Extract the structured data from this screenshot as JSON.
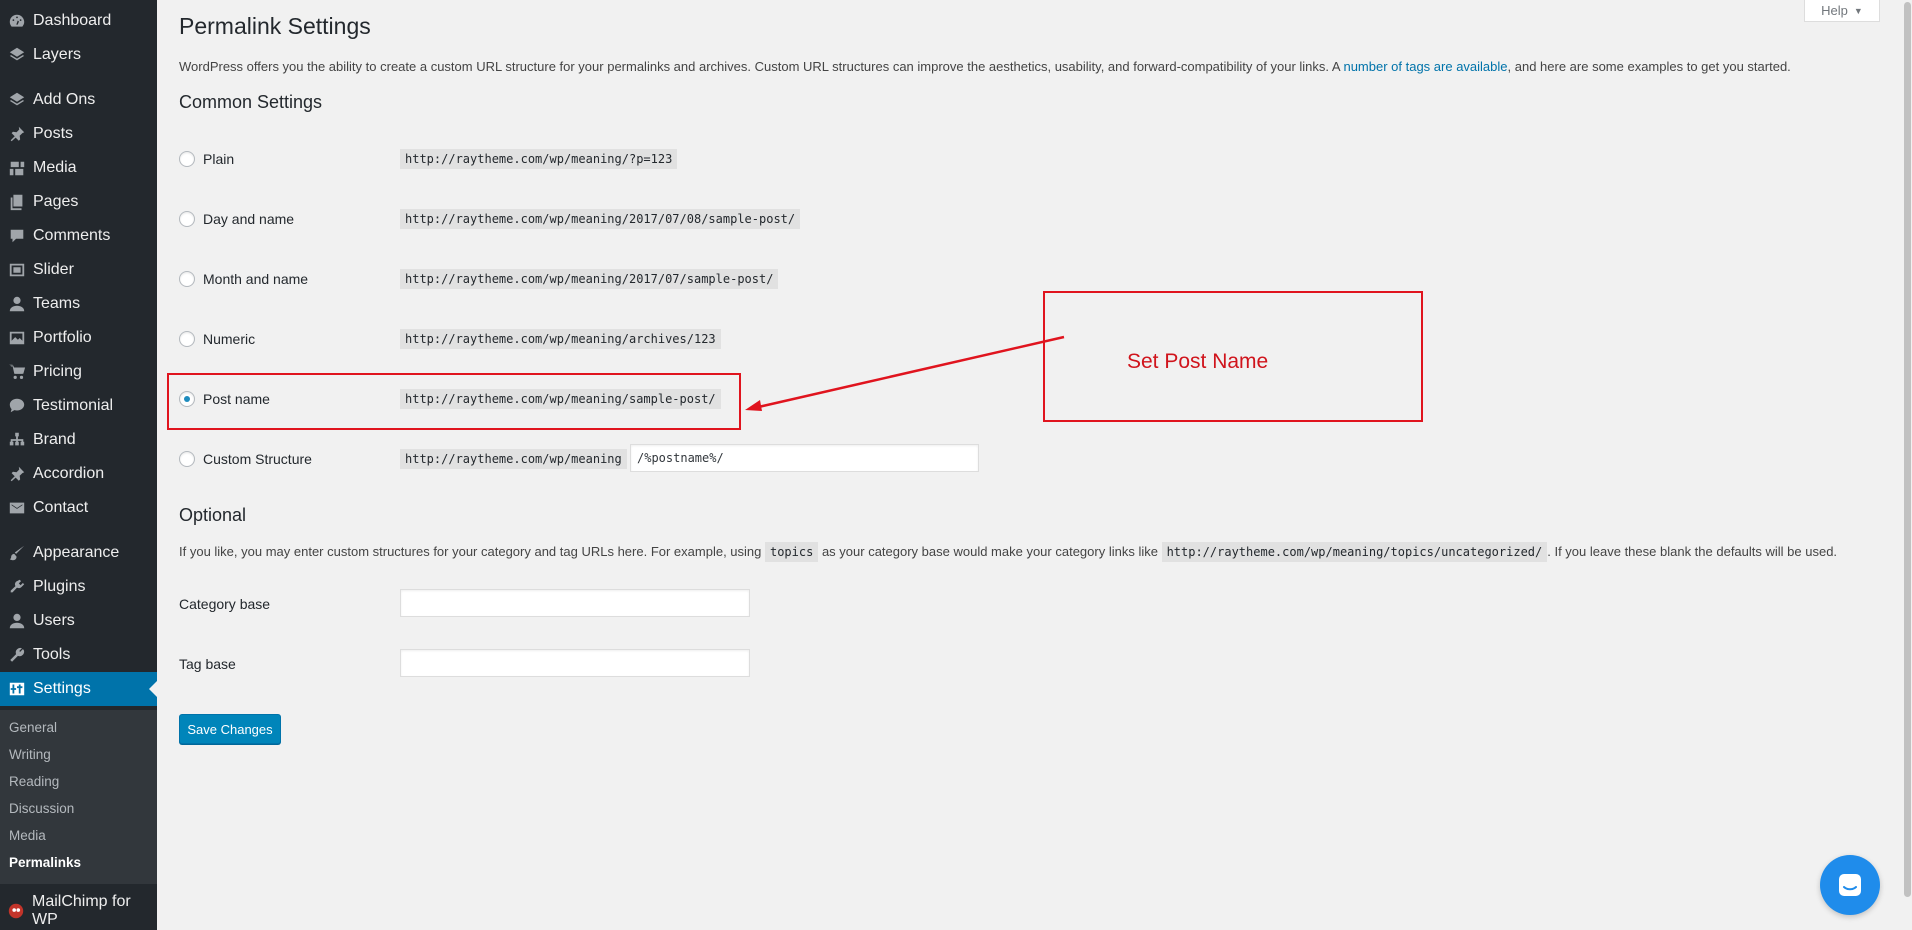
{
  "sidebar": {
    "items": [
      {
        "label": "Dashboard",
        "icon": "dashboard-icon"
      },
      {
        "label": "Layers",
        "icon": "layers-icon"
      },
      {
        "label": "Add Ons",
        "icon": "add-ons-icon"
      },
      {
        "label": "Posts",
        "icon": "pin-icon"
      },
      {
        "label": "Media",
        "icon": "media-icon"
      },
      {
        "label": "Pages",
        "icon": "pages-icon"
      },
      {
        "label": "Comments",
        "icon": "comment-icon"
      },
      {
        "label": "Slider",
        "icon": "slider-icon"
      },
      {
        "label": "Teams",
        "icon": "user-icon"
      },
      {
        "label": "Portfolio",
        "icon": "portfolio-icon"
      },
      {
        "label": "Pricing",
        "icon": "cart-icon"
      },
      {
        "label": "Testimonial",
        "icon": "chat-bubble-icon"
      },
      {
        "label": "Brand",
        "icon": "network-icon"
      },
      {
        "label": "Accordion",
        "icon": "pin-icon"
      },
      {
        "label": "Contact",
        "icon": "mail-icon"
      },
      {
        "label": "Appearance",
        "icon": "brush-icon"
      },
      {
        "label": "Plugins",
        "icon": "plugin-icon"
      },
      {
        "label": "Users",
        "icon": "user-icon"
      },
      {
        "label": "Tools",
        "icon": "wrench-icon"
      },
      {
        "label": "Settings",
        "icon": "settings-icon"
      },
      {
        "label": "MailChimp for WP",
        "icon": "mailchimp-icon"
      }
    ],
    "submenu": [
      "General",
      "Writing",
      "Reading",
      "Discussion",
      "Media",
      "Permalinks"
    ]
  },
  "help_tab": {
    "label": "Help"
  },
  "page": {
    "title": "Permalink Settings",
    "intro_before": "WordPress offers you the ability to create a custom URL structure for your permalinks and archives. Custom URL structures can improve the aesthetics, usability, and forward-compatibility of your links. A ",
    "intro_link": "number of tags are available",
    "intro_after": ", and here are some examples to get you started.",
    "common_heading": "Common Settings",
    "options": [
      {
        "label": "Plain",
        "url": "http://raytheme.com/wp/meaning/?p=123",
        "checked": false
      },
      {
        "label": "Day and name",
        "url": "http://raytheme.com/wp/meaning/2017/07/08/sample-post/",
        "checked": false
      },
      {
        "label": "Month and name",
        "url": "http://raytheme.com/wp/meaning/2017/07/sample-post/",
        "checked": false
      },
      {
        "label": "Numeric",
        "url": "http://raytheme.com/wp/meaning/archives/123",
        "checked": false
      },
      {
        "label": "Post name",
        "url": "http://raytheme.com/wp/meaning/sample-post/",
        "checked": true
      },
      {
        "label": "Custom Structure",
        "url": "http://raytheme.com/wp/meaning",
        "checked": false
      }
    ],
    "custom_structure_value": "/%postname%/",
    "optional_heading": "Optional",
    "optional_text_1": "If you like, you may enter custom structures for your category and tag URLs here. For example, using ",
    "optional_code_1": "topics",
    "optional_text_2": " as your category base would make your category links like ",
    "optional_code_2": "http://raytheme.com/wp/meaning/topics/uncategorized/",
    "optional_text_3": ". If you leave these blank the defaults will be used.",
    "category_base_label": "Category base",
    "category_base_value": "",
    "tag_base_label": "Tag base",
    "tag_base_value": "",
    "save_label": "Save Changes"
  },
  "annotation": {
    "text": "Set Post Name",
    "color": "#e0141e"
  },
  "colors": {
    "accent": "#0073aa",
    "sidebar": "#23282d",
    "submenu": "#32373c",
    "chat": "#1f8ceb"
  }
}
